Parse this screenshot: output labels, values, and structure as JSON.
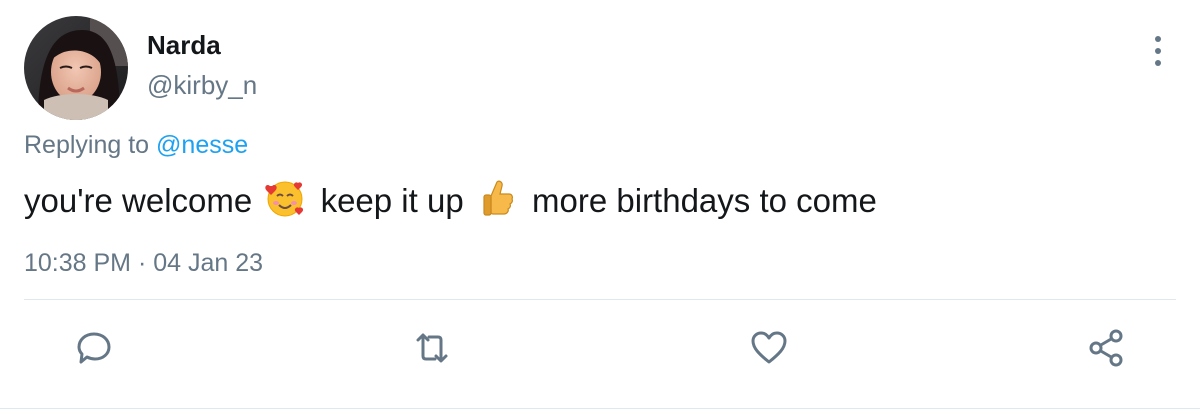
{
  "user": {
    "display_name": "Narda",
    "handle": "@kirby_n"
  },
  "reply": {
    "prefix": "Replying to",
    "mention": "@nesse"
  },
  "tweet": {
    "part1": "you're welcome",
    "emoji1": "smiling-face-with-hearts",
    "part2": "keep it up",
    "emoji2": "thumbs-up",
    "part3": "more birthdays to come"
  },
  "meta": {
    "time": "10:38 PM",
    "separator": "·",
    "date": "04 Jan 23"
  },
  "actions": [
    {
      "icon": "reply-icon"
    },
    {
      "icon": "retweet-icon"
    },
    {
      "icon": "like-icon"
    },
    {
      "icon": "share-icon"
    }
  ],
  "colors": {
    "text": "#14171a",
    "secondary": "#657786",
    "link": "#1da1f2",
    "divider": "#e1e8ed"
  }
}
